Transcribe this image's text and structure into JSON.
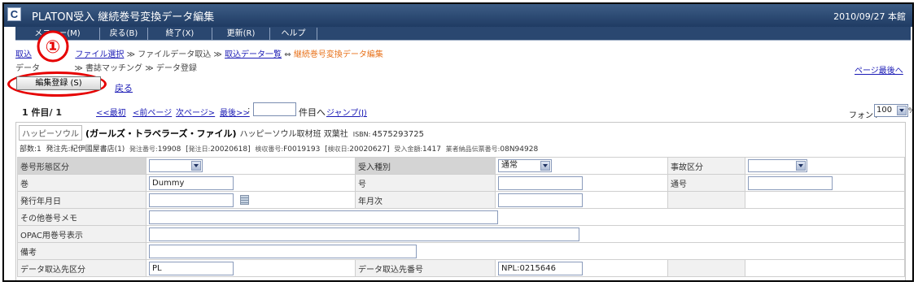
{
  "window": {
    "logo_letter": "C",
    "title": "PLATON受入 継続巻号変換データ編集",
    "date_user": "2010/09/27 本館"
  },
  "menu": [
    {
      "label": "メニュー(M)"
    },
    {
      "label": "戻る(B)"
    },
    {
      "label": "終了(X)"
    },
    {
      "label": "更新(R)"
    },
    {
      "label": "ヘルプ"
    }
  ],
  "breadcrumb": {
    "item1": "取込",
    "item2": "ファイル選択",
    "sep": "≫",
    "item3": "ファイルデータ取込",
    "item4": "取込データ一覧",
    "arrow": "⇔",
    "item5": "継続巻号変換データ編集",
    "line2_item1": "データ",
    "line2_item2": "書誌マッチング",
    "line2_item3": "データ登録"
  },
  "annotation": {
    "marker": "①",
    "color": "#e60000"
  },
  "toolbar": {
    "edit_register_label": "編集登録 (S)",
    "back_label": "戻る",
    "page_last_label": "ページ最後へ"
  },
  "pager": {
    "position": "1 件目/ 1",
    "first": "<<最初",
    "prev": "<前ページ",
    "next": "次ページ>",
    "last": "最後>>",
    "colon": ":",
    "page_input_value": "",
    "suffix": "件目へ",
    "jump": "ジャンプ(J)"
  },
  "font": {
    "label": "フォント",
    "value": "100",
    "pct": "%"
  },
  "record": {
    "kana": "ハッピーソウル",
    "title": "(ガールズ・トラベラーズ・ファイル)",
    "publisher": "ハッピーソウル取材班 双葉社",
    "isbn_label": "ISBN:",
    "isbn": "4575293725",
    "copies_label": "部数:",
    "copies": "1",
    "vendor_label": "発注先:",
    "vendor": "紀伊國屋書店(1)",
    "order_no_label": "発注番号:",
    "order_no": "19908",
    "order_date_label": "発注日:",
    "order_date": "20020618",
    "inspect_no_label": "検収番号:",
    "inspect_no": "F0019193",
    "inspect_date_label": "検収日:",
    "inspect_date": "20020627",
    "amount_label": "受入金額:",
    "amount": "1417",
    "invoice_label": "業者納品伝票番号:",
    "invoice": "08N94928"
  },
  "form": {
    "volume_type_label": "巻号形態区分",
    "volume_type_value": "",
    "receive_type_label": "受入種別",
    "receive_type_value": "通常",
    "accident_label": "事故区分",
    "accident_value": "",
    "volume_label": "巻",
    "volume_value": "Dummy",
    "issue_label": "号",
    "issue_value": "",
    "serial_label": "通号",
    "serial_value": "",
    "pub_date_label": "発行年月日",
    "pub_date_value": "",
    "year_month_label": "年月次",
    "year_month_value": "",
    "other_memo_label": "その他巻号メモ",
    "other_memo_value": "",
    "opac_label": "OPAC用巻号表示",
    "opac_value": "",
    "remarks_label": "備考",
    "remarks_value": "",
    "import_src_label": "データ取込先区分",
    "import_src_value": "PL",
    "import_no_label": "データ取込先番号",
    "import_no_value": "NPL:0215646"
  }
}
